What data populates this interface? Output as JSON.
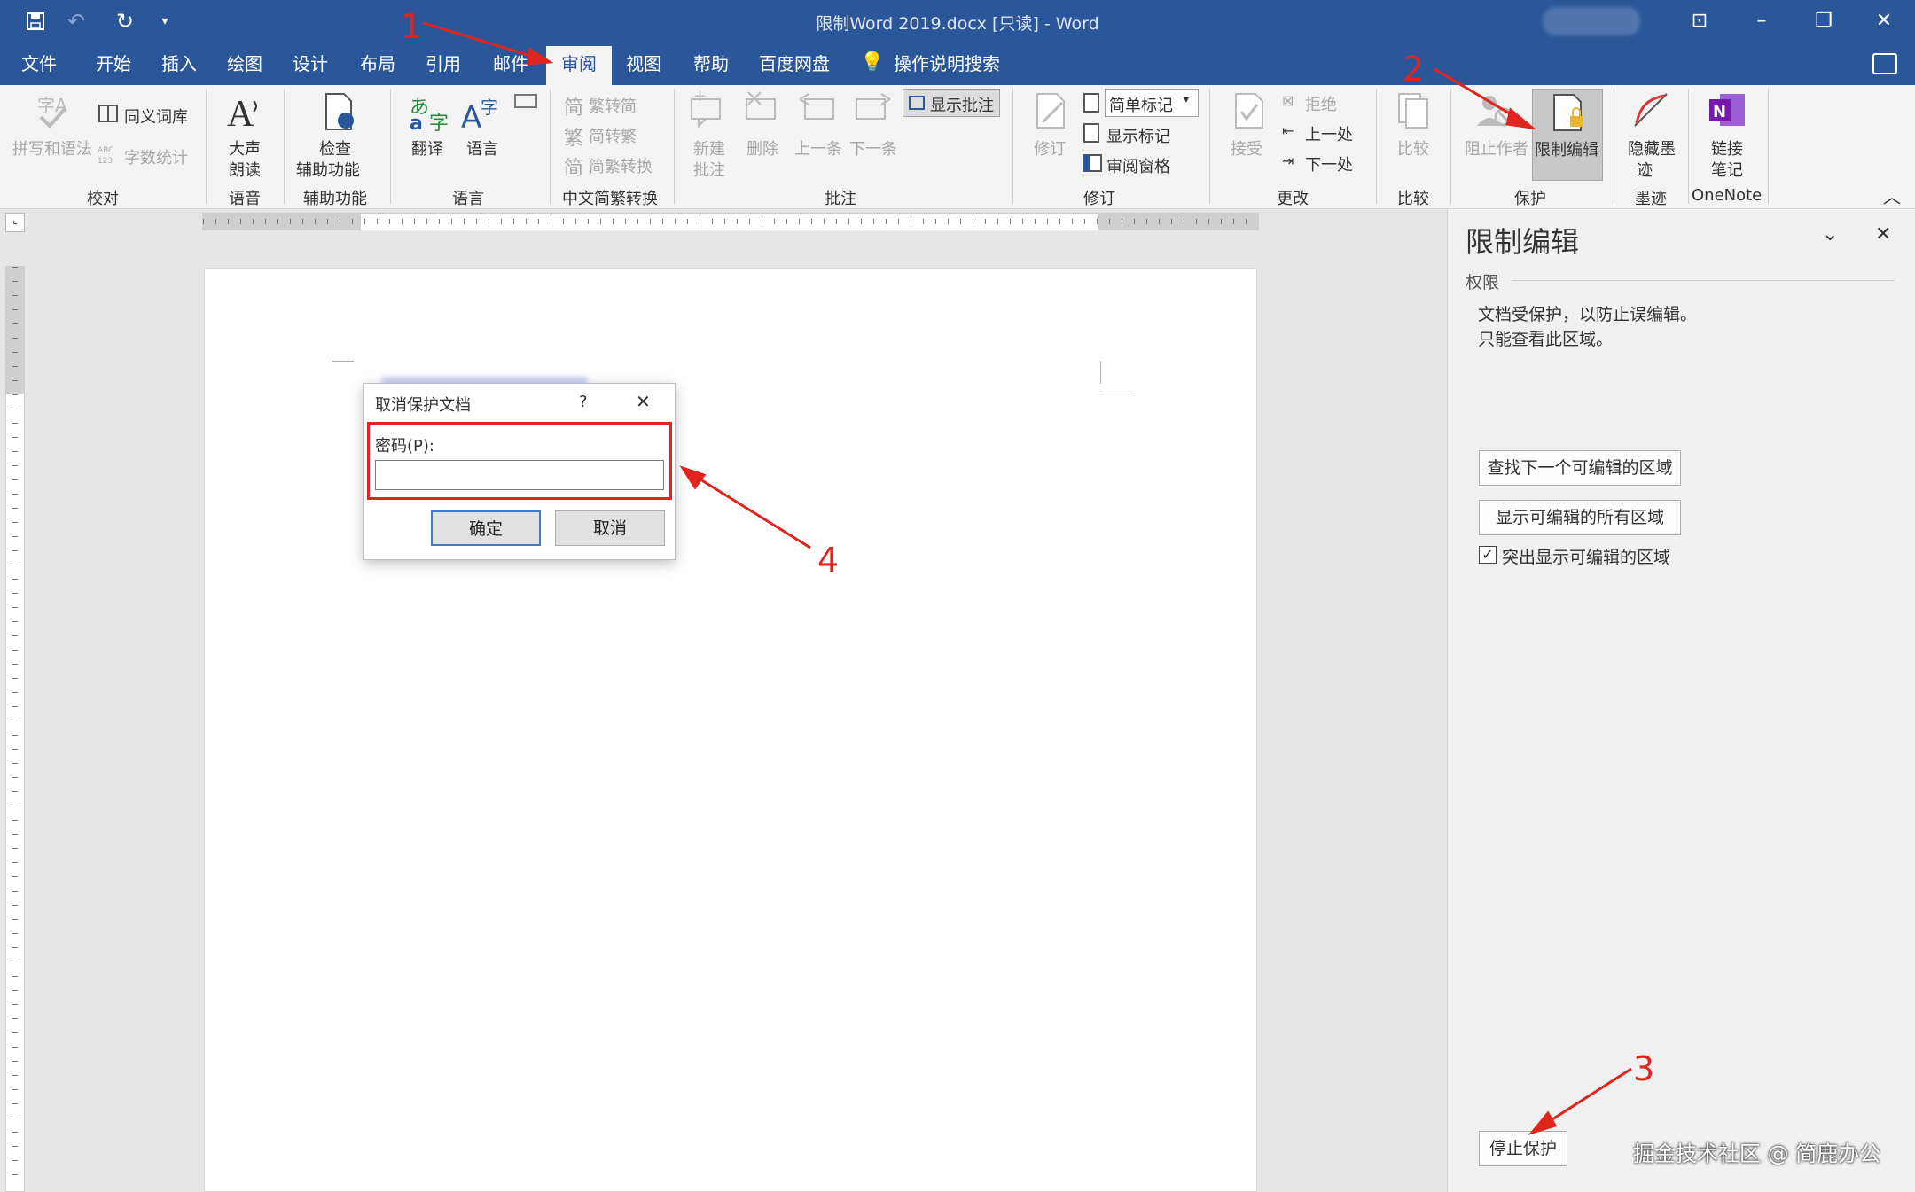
{
  "window": {
    "title": "限制Word 2019.docx [只读]  -  Word"
  },
  "tabs": [
    "文件",
    "开始",
    "插入",
    "绘图",
    "设计",
    "布局",
    "引用",
    "邮件",
    "审阅",
    "视图",
    "帮助",
    "百度网盘"
  ],
  "tell_me": "操作说明搜索",
  "ribbon": {
    "proofing": {
      "spell": "拼写和语法",
      "thesaurus": "同义词库",
      "wordcount": "字数统计",
      "group": "校对"
    },
    "speech": {
      "read1": "大声",
      "read2": "朗读",
      "group": "语音"
    },
    "access": {
      "check1": "检查",
      "check2": "辅助功能",
      "group": "辅助功能"
    },
    "language": {
      "translate": "翻译",
      "lang": "语言",
      "group": "语言"
    },
    "chinese": {
      "t2s": "繁转简",
      "s2t": "简转繁",
      "conv": "简繁转换",
      "group": "中文简繁转换"
    },
    "comments": {
      "new1": "新建",
      "new2": "批注",
      "delete": "删除",
      "prev": "上一条",
      "next": "下一条",
      "show": "显示批注",
      "group": "批注"
    },
    "tracking": {
      "track": "修订",
      "simple": "简单标记",
      "showmark": "显示标记",
      "pane": "审阅窗格",
      "group": "修订"
    },
    "changes": {
      "accept": "接受",
      "reject": "拒绝",
      "prev": "上一处",
      "next": "下一处",
      "group": "更改"
    },
    "compare": {
      "compare": "比较",
      "group": "比较"
    },
    "protect": {
      "block": "阻止作者",
      "restrict": "限制编辑",
      "group": "保护"
    },
    "ink": {
      "hide1": "隐藏墨",
      "hide2": "迹",
      "group": "墨迹"
    },
    "onenote": {
      "link1": "链接",
      "link2": "笔记",
      "group": "OneNote"
    }
  },
  "pane": {
    "title": "限制编辑",
    "section": "权限",
    "msg1": "文档受保护，以防止误编辑。",
    "msg2": "只能查看此区域。",
    "find_next": "查找下一个可编辑的区域",
    "show_all": "显示可编辑的所有区域",
    "highlight": "突出显示可编辑的区域",
    "stop": "停止保护"
  },
  "dialog": {
    "title": "取消保护文档",
    "help": "?",
    "label": "密码(P):",
    "password_value": "",
    "ok": "确定",
    "cancel": "取消"
  },
  "annotations": [
    "1",
    "2",
    "3",
    "4"
  ],
  "watermark": "掘金技术社区 @ 简鹿办公",
  "colors": {
    "accent": "#2b579a",
    "annotation": "#e0251e"
  }
}
